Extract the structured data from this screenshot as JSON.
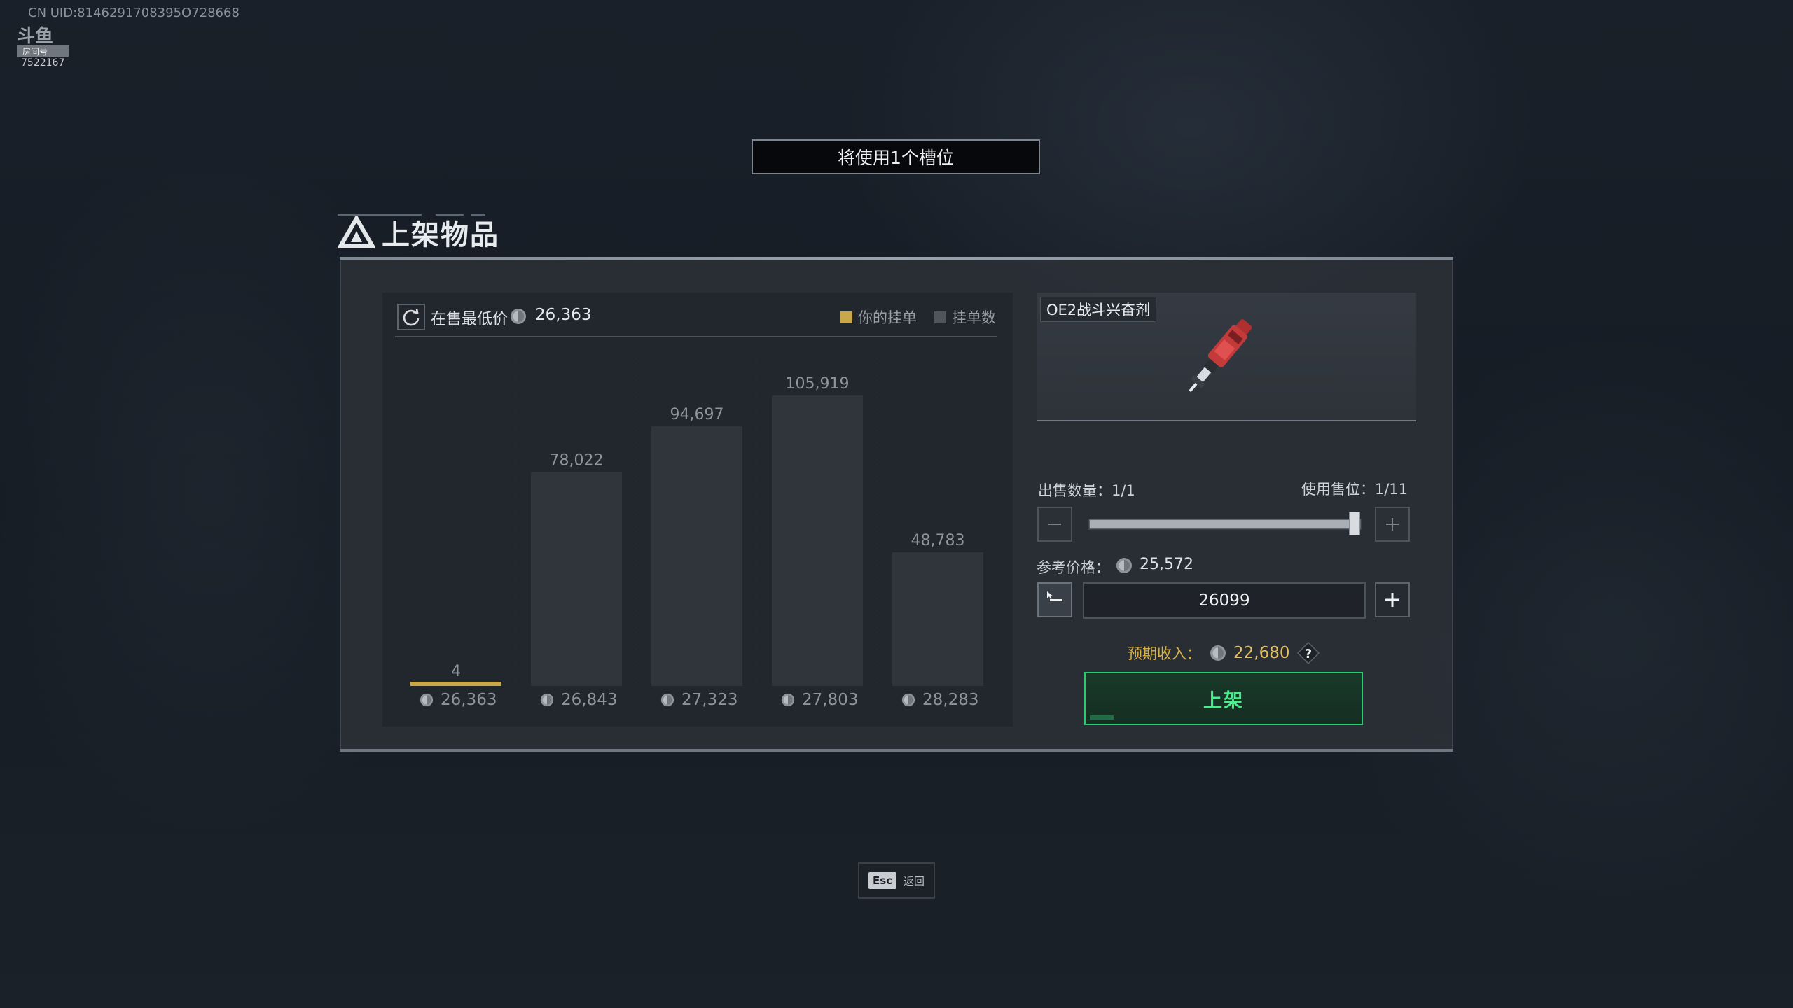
{
  "watermark": {
    "uid": "CN UID:8146291708395O728668",
    "logo_text": "斗鱼",
    "logo_sub": "房间号",
    "room_id": "7522167"
  },
  "slot_banner": "将使用1个槽位",
  "title": "上架物品",
  "chart_header": {
    "lowest_label": "在售最低价",
    "lowest_value": "26,363",
    "legend_yours": "你的挂单",
    "legend_count": "挂单数"
  },
  "chart_data": {
    "type": "bar",
    "categories": [
      "26,363",
      "26,843",
      "27,323",
      "27,803",
      "28,283"
    ],
    "series": [
      {
        "name": "挂单数",
        "values": [
          0,
          78022,
          94697,
          105919,
          48783
        ]
      },
      {
        "name": "你的挂单",
        "values": [
          4,
          0,
          0,
          0,
          0
        ]
      }
    ],
    "value_labels": [
      "4",
      "78,022",
      "94,697",
      "105,919",
      "48,783"
    ],
    "ylim": [
      0,
      120000
    ],
    "legend_position": "top-right",
    "grid": false
  },
  "item": {
    "name": "OE2战斗兴奋剂",
    "icon": "red-syringe-icon"
  },
  "sell": {
    "quantity_label": "出售数量：1/1",
    "slots_label": "使用售位：1/11",
    "quantity_fraction": 1.0
  },
  "price": {
    "reference_label": "参考价格：",
    "reference_value": "25,572",
    "input_value": "26099"
  },
  "income": {
    "label": "预期收入：",
    "value": "22,680"
  },
  "actions": {
    "list_label": "上架",
    "esc_key": "Esc",
    "esc_label": "返回"
  },
  "colors": {
    "accent_green": "#23d06d",
    "accent_gold": "#d6b04a",
    "bar_fill": "#30353c",
    "your_listing": "#c9a84a"
  }
}
